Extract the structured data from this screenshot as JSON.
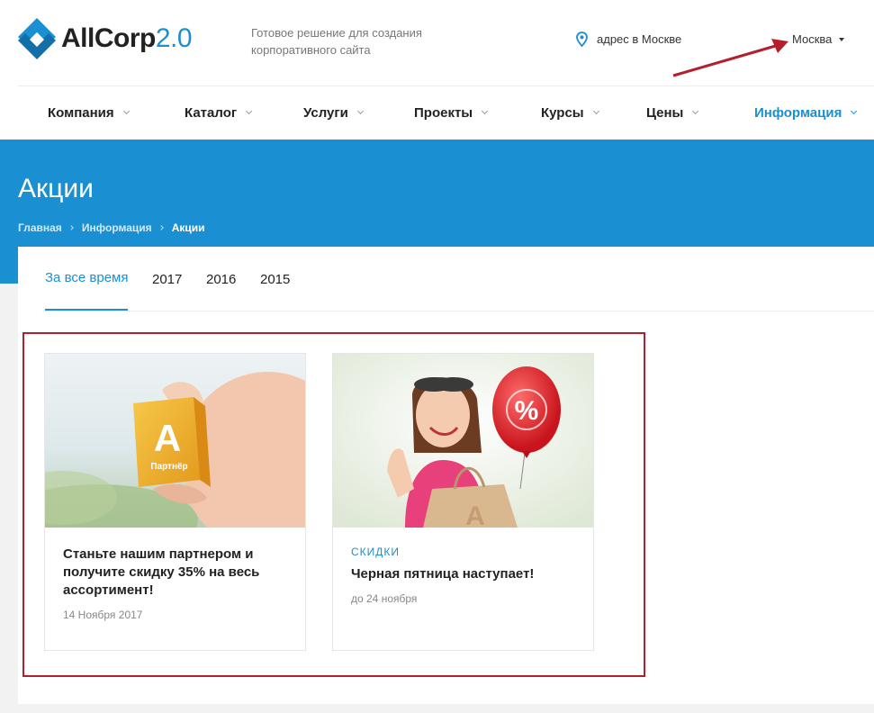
{
  "header": {
    "logo_main": "AllCorp",
    "logo_version": "2.0",
    "tagline": "Готовое решение для создания корпоративного сайта",
    "address": "адрес в Москве",
    "city": "Москва"
  },
  "nav": {
    "items": [
      {
        "label": "Компания"
      },
      {
        "label": "Каталог"
      },
      {
        "label": "Услуги"
      },
      {
        "label": "Проекты"
      },
      {
        "label": "Курсы"
      },
      {
        "label": "Цены"
      },
      {
        "label": "Информация",
        "active": true
      }
    ]
  },
  "page": {
    "title": "Акции",
    "breadcrumb": [
      "Главная",
      "Информация",
      "Акции"
    ]
  },
  "tabs": [
    {
      "label": "За все время",
      "active": true
    },
    {
      "label": "2017"
    },
    {
      "label": "2016"
    },
    {
      "label": "2015"
    }
  ],
  "cards": [
    {
      "tag": "",
      "title": "Станьте нашим партнером и получите скидку 35% на весь ассортимент!",
      "date": "14 Ноября 2017",
      "badge_letter": "A",
      "badge_text": "Партнёр"
    },
    {
      "tag": "скидки",
      "title": "Черная пятница наступает!",
      "date": "до 24 ноября",
      "balloon_text": "%",
      "bag_letter": "A"
    }
  ],
  "colors": {
    "accent": "#1a8fd2",
    "highlight": "#b3202c",
    "arrow": "#b3202c"
  }
}
